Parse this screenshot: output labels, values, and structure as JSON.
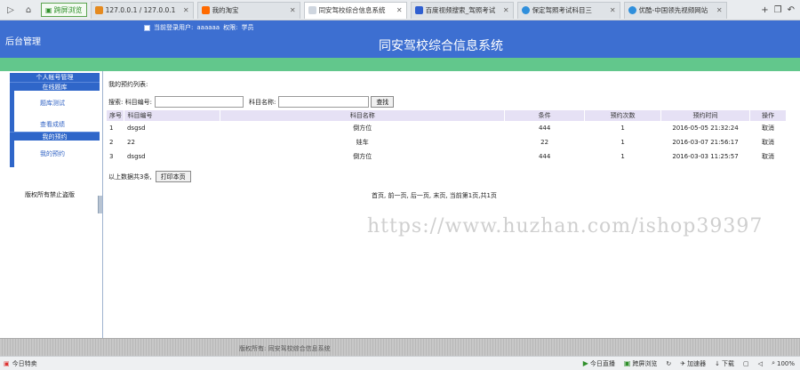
{
  "browser": {
    "fullscreen_label": "跨屏浏览",
    "tabs": [
      {
        "label": "127.0.0.1 / 127.0.0.1",
        "icon_color": "#e58a1f"
      },
      {
        "label": "我的淘宝",
        "icon_color": "#ff6a00"
      },
      {
        "label": "同安驾校综合信息系统",
        "icon_color": "#cfd6df"
      },
      {
        "label": "百度视频搜索_驾照考试",
        "icon_color": "#2f5fd0"
      },
      {
        "label": "保定驾照考试科目三",
        "icon_color": "#2f8fdc"
      },
      {
        "label": "优酷-中国领先视频网站",
        "icon_color": "#2f8fdc"
      }
    ],
    "status": {
      "left": "今日特卖",
      "live": "今日直播",
      "fullscreen": "跨屏浏览",
      "speed": "加速器",
      "download": "下载",
      "zoom": "100%"
    }
  },
  "header": {
    "admin_title": "后台管理",
    "current_user_label": "当前登录用户:",
    "current_user_value": "aaaaaa",
    "role_label": "权限:",
    "role_value": "学员",
    "system_title": "同安驾校综合信息系统"
  },
  "sidebar": {
    "section_title": "个人帐号管理",
    "group1_title": "在线题库",
    "group1_items": [
      "题库测试",
      "查看成绩"
    ],
    "group2_title": "我的预约",
    "group2_items": [
      "我的预约"
    ],
    "copyright": "版权所有禁止盗版"
  },
  "main": {
    "list_title": "我的预约列表:",
    "search": {
      "label": "搜索: 科目编号:",
      "name_label": "科目名称:",
      "button": "查找"
    },
    "table": {
      "headers": [
        "序号",
        "科目编号",
        "科目名称",
        "条件",
        "预约次数",
        "预约时间",
        "操作"
      ],
      "rows": [
        [
          "1",
          "dsgsd",
          "倒方位",
          "444",
          "1",
          "2016-05-05 21:32:24",
          "取消"
        ],
        [
          "2",
          "22",
          "娃车",
          "22",
          "1",
          "2016-03-07 21:56:17",
          "取消"
        ],
        [
          "3",
          "dsgsd",
          "倒方位",
          "444",
          "1",
          "2016-03-03 11:25:57",
          "取消"
        ]
      ]
    },
    "summary_text": "以上数据共3条,",
    "print_button": "打印本页",
    "pager_text": "首页, 前一页, 后一页, 末页, 当前第1页,共1页",
    "watermark": "https://www.huzhan.com/ishop39397"
  },
  "footer": {
    "text": "版权所有: 同安驾校综合信息系统"
  }
}
